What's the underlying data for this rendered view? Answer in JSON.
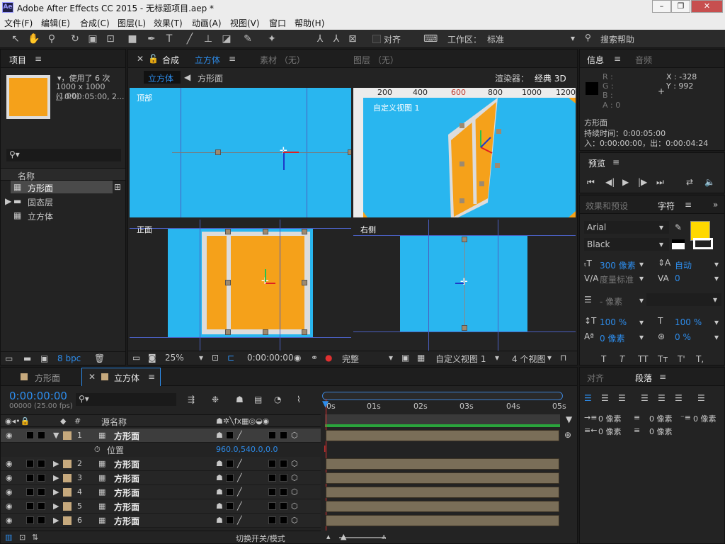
{
  "app": {
    "icon": "Ae",
    "title": "Adobe After Effects CC 2015 - 无标题项目.aep *",
    "win": [
      "–",
      "❐",
      "✕"
    ]
  },
  "menu": [
    "文件(F)",
    "编辑(E)",
    "合成(C)",
    "图层(L)",
    "效果(T)",
    "动画(A)",
    "视图(V)",
    "窗口",
    "帮助(H)"
  ],
  "toolbar": {
    "snap_label": "对齐",
    "workspace_label": "工作区：",
    "workspace_value": "标准",
    "search_help": "搜索帮助"
  },
  "project": {
    "tab": "项目",
    "used": "▾，使用了 6 次",
    "dims": "1000 x 1000 (1.00)",
    "dur": "△ 0:00:05:00, 2...",
    "col_name": "名称",
    "items": [
      "方形面",
      "固态层",
      "立方体"
    ],
    "bpc": "8 bpc"
  },
  "comp": {
    "tab_comp": "合成",
    "tab_comp_name": "立方体",
    "tab_footage": "素材 （无）",
    "tab_layer": "图层 （无）",
    "crumb_active": "立方体",
    "crumb_other": "方形面",
    "renderer_label": "渲染器：",
    "renderer_value": "经典 3D",
    "views": {
      "top": "顶部",
      "custom": "自定义视图 1",
      "front": "正面",
      "right": "右侧"
    },
    "ruler": [
      "200",
      "400",
      "600",
      "800",
      "1000",
      "1200"
    ],
    "footer": {
      "zoom": "25%",
      "time": "0:00:00:00",
      "quality": "完整",
      "view": "自定义视图 1",
      "layout": "4 个视图"
    }
  },
  "info": {
    "tab": "信息",
    "tab2": "音频",
    "r": "R :",
    "g": "G :",
    "b": "B :",
    "a": "A : 0",
    "x": "X : -328",
    "y": "Y : 992",
    "name": "方形面",
    "duration": "持续时间：0:00:05:00",
    "inout": "入：0:00:00:00，出：0:00:04:24"
  },
  "preview": {
    "tab": "预览"
  },
  "character": {
    "tab_effects": "效果和预设",
    "tab": "字符",
    "font": "Arial",
    "style": "Black",
    "size": "300 像素",
    "leading": "自动",
    "kern": "度量标准",
    "track": "0",
    "stroke": "- 像素",
    "vscale": "100 %",
    "hscale": "100 %",
    "baseline": "0 像素",
    "tsume": "0 %",
    "fill_color": "#ffd800",
    "styles": [
      "T",
      "T",
      "TT",
      "Tт",
      "T'",
      "T,"
    ]
  },
  "paragraph": {
    "tab_align": "对齐",
    "tab": "段落",
    "indent": [
      "0 像素",
      "0 像素",
      "0 像素",
      "0 像素",
      "0 像素"
    ]
  },
  "timeline": {
    "tab1": "方形面",
    "tab2": "立方体",
    "time": "0:00:00:00",
    "fps": "00000 (25.00 fps)",
    "col_source": "源名称",
    "ticks": [
      "0s",
      "01s",
      "02s",
      "03s",
      "04s",
      "05s"
    ],
    "layers": [
      {
        "num": "1",
        "name": "方形面"
      },
      {
        "num": "2",
        "name": "方形面"
      },
      {
        "num": "3",
        "name": "方形面"
      },
      {
        "num": "4",
        "name": "方形面"
      },
      {
        "num": "5",
        "name": "方形面"
      },
      {
        "num": "6",
        "name": "方形面"
      }
    ],
    "position_label": "位置",
    "position_value": "960.0,540.0,0.0",
    "toggle_label": "切换开关/模式"
  }
}
